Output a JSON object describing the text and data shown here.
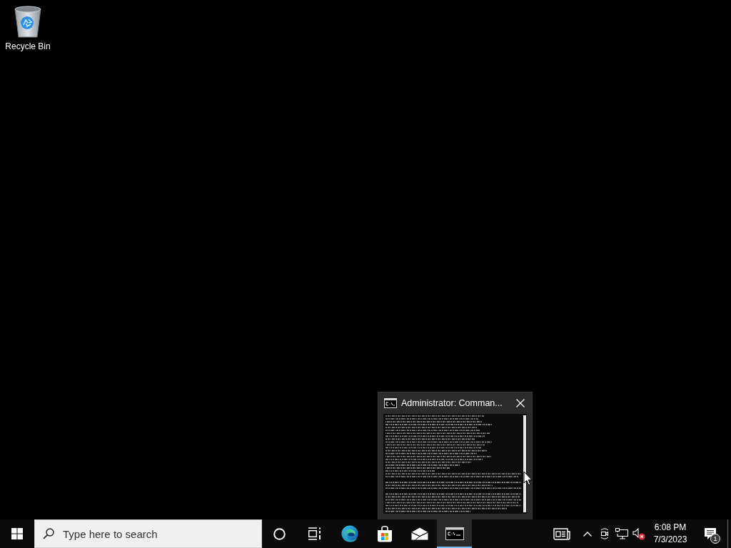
{
  "desktop": {
    "icons": [
      {
        "kind": "recycle-bin",
        "label": "Recycle Bin"
      }
    ]
  },
  "thumbnail": {
    "title": "Administrator: Comman..."
  },
  "taskbar": {
    "search": {
      "placeholder": "Type here to search"
    },
    "apps": [
      {
        "kind": "cortana",
        "selected": false
      },
      {
        "kind": "task-view",
        "selected": false
      },
      {
        "kind": "edge",
        "selected": false
      },
      {
        "kind": "store",
        "selected": false
      },
      {
        "kind": "mail",
        "selected": false
      },
      {
        "kind": "console",
        "selected": true
      }
    ],
    "tray": [
      {
        "kind": "news"
      },
      {
        "kind": "overflow"
      },
      {
        "kind": "meet"
      },
      {
        "kind": "network"
      },
      {
        "kind": "volume",
        "muted": true
      }
    ],
    "clock": {
      "time": "6:08 PM",
      "date": "7/3/2023"
    },
    "notifications": {
      "count": "1"
    }
  }
}
